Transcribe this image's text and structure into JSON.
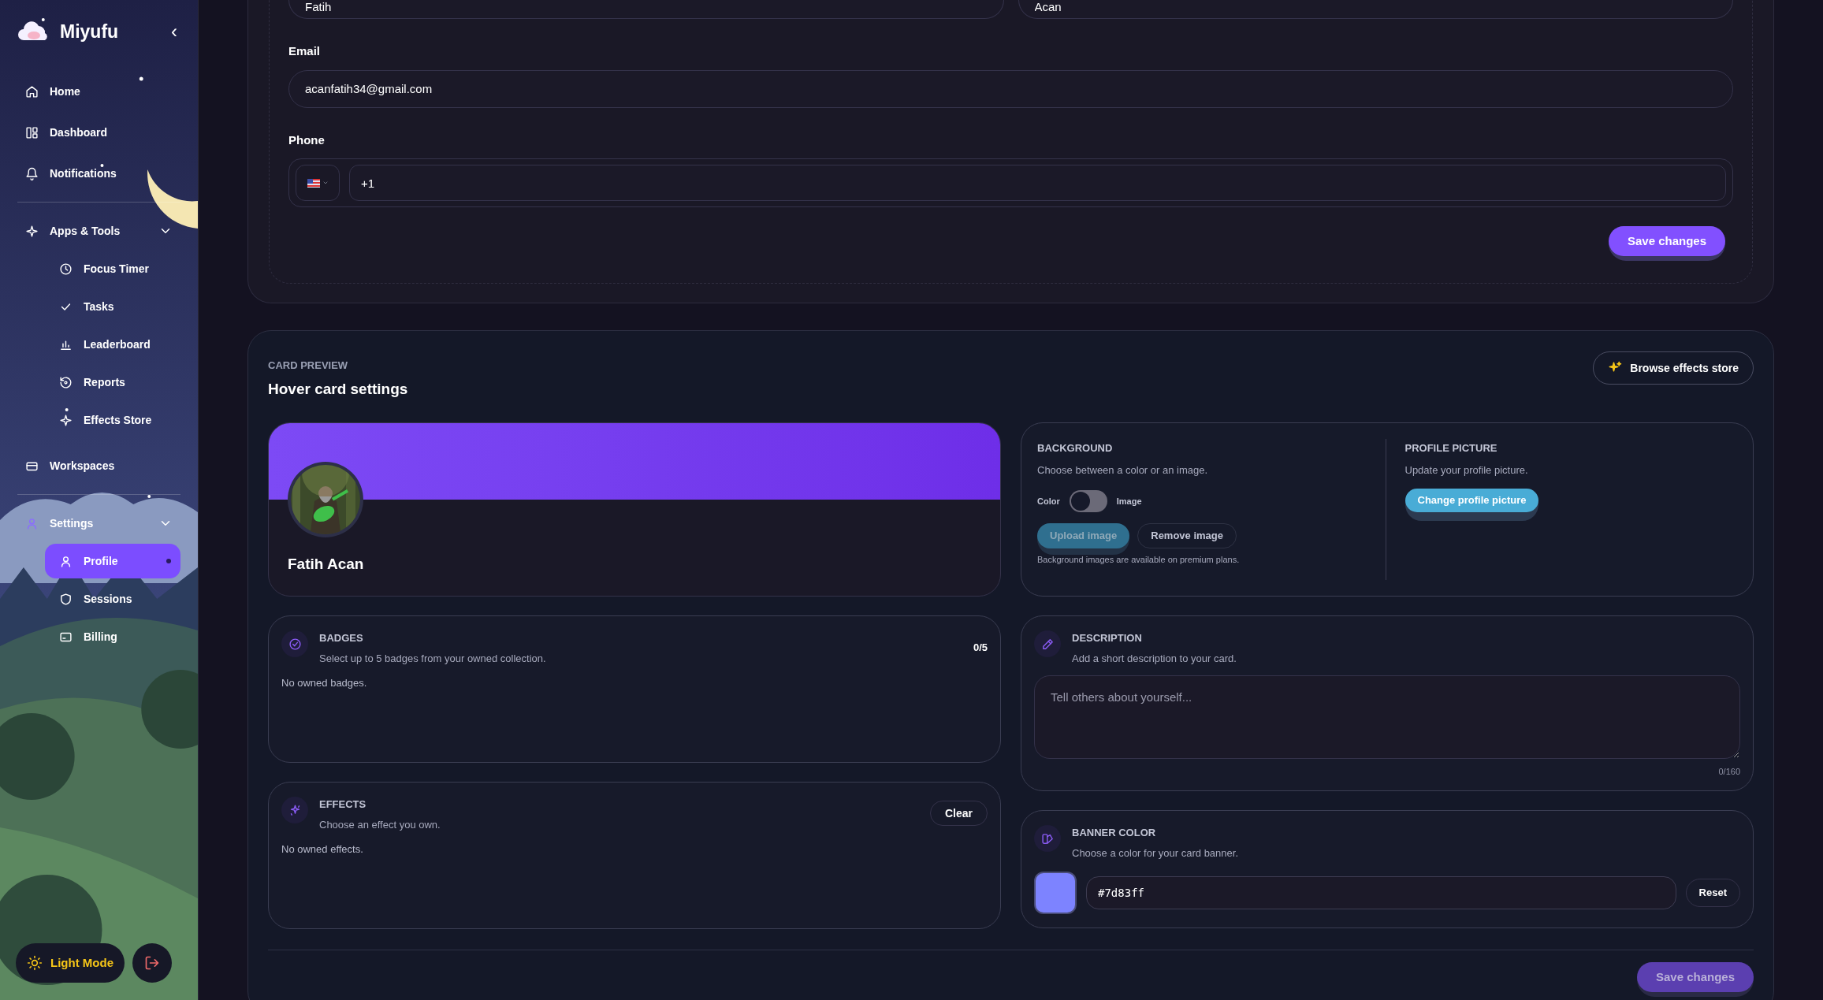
{
  "sidebar": {
    "brand": "Miyufu",
    "collapse_glyph": "‹",
    "items": [
      {
        "label": "Home",
        "selected": false
      },
      {
        "label": "Dashboard",
        "selected": false
      },
      {
        "label": "Notifications",
        "selected": false
      },
      {
        "label": "Apps & Tools",
        "selected": false,
        "expanded": true,
        "children": [
          {
            "label": "Focus Timer",
            "selected": false
          },
          {
            "label": "Tasks",
            "selected": false
          },
          {
            "label": "Leaderboard",
            "selected": false
          },
          {
            "label": "Reports",
            "selected": false
          },
          {
            "label": "Effects Store",
            "selected": false
          }
        ]
      },
      {
        "label": "Workspaces",
        "selected": false
      },
      {
        "label": "Settings",
        "selected": false,
        "expanded": true,
        "children": [
          {
            "label": "Profile",
            "selected": true
          },
          {
            "label": "Sessions",
            "selected": false
          },
          {
            "label": "Billing",
            "selected": false
          }
        ]
      }
    ],
    "theme_button": "Light Mode"
  },
  "account_form": {
    "first_name": "Fatih",
    "last_name": "Acan",
    "email_label": "Email",
    "email": "acanfatih34@gmail.com",
    "phone_label": "Phone",
    "phone": "+1",
    "save": {
      "label": "Save changes",
      "disabled": false
    }
  },
  "card_preview": {
    "eyebrow": "CARD PREVIEW",
    "title": "Hover card settings",
    "browse_button": "Browse effects store",
    "display_name": "Fatih Acan",
    "background": {
      "title": "BACKGROUND",
      "subtitle": "Choose between a color or an image.",
      "toggle": {
        "left_label": "Color",
        "right_label": "Image",
        "on": false
      },
      "upload": {
        "label": "Upload image",
        "disabled": true
      },
      "remove": "Remove image",
      "note": "Background images are available on premium plans."
    },
    "profile_picture": {
      "title": "PROFILE PICTURE",
      "subtitle": "Update your profile picture.",
      "button": "Change profile picture"
    },
    "badges": {
      "title": "BADGES",
      "subtitle": "Select up to 5 badges from your owned collection.",
      "count": "0/5",
      "empty": "No owned badges."
    },
    "effects": {
      "title": "EFFECTS",
      "subtitle": "Choose an effect you own.",
      "clear": "Clear",
      "empty": "No owned effects."
    },
    "description": {
      "title": "DESCRIPTION",
      "subtitle": "Add a short description to your card.",
      "placeholder": "Tell others about yourself...",
      "counter": "0/160"
    },
    "banner_color": {
      "title": "BANNER COLOR",
      "subtitle": "Choose a color for your card banner.",
      "value": "#7d83ff",
      "reset": "Reset"
    },
    "save": {
      "label": "Save changes",
      "disabled": true
    }
  }
}
